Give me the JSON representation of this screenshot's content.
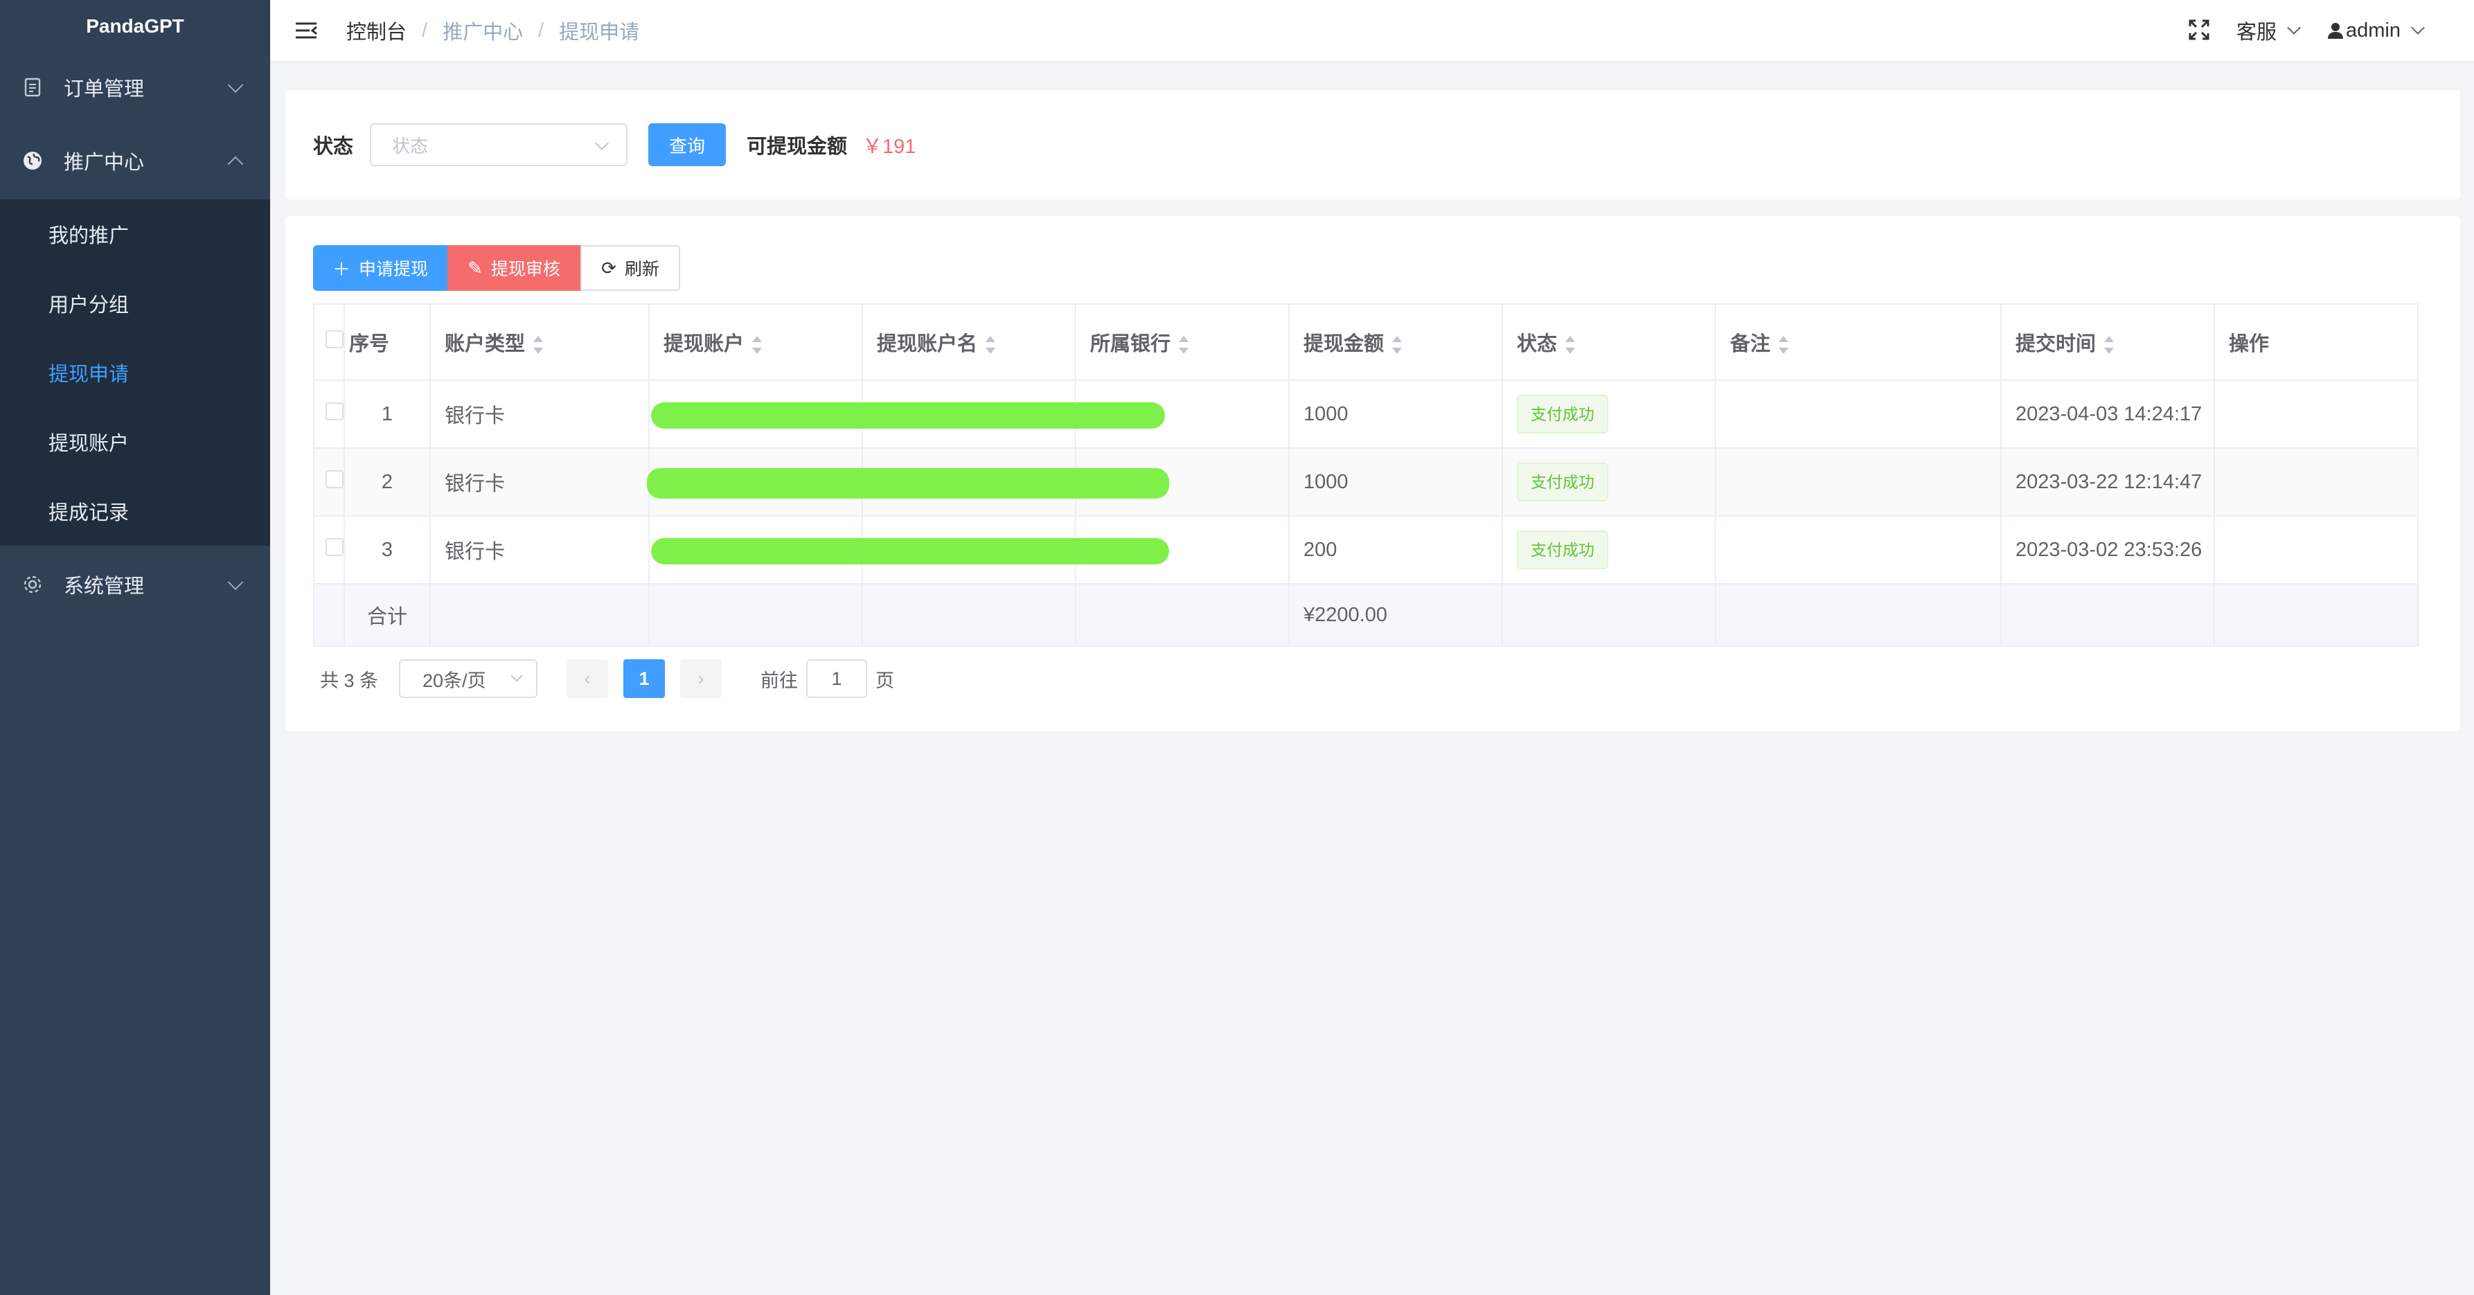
{
  "app": {
    "title": "PandaGPT"
  },
  "sidebar": {
    "items": [
      {
        "label": "订单管理",
        "icon": "document-icon",
        "expanded": false
      },
      {
        "label": "推广中心",
        "icon": "globe-icon",
        "expanded": true,
        "children": [
          "我的推广",
          "用户分组",
          "提现申请",
          "提现账户",
          "提成记录"
        ],
        "active_child": "提现申请"
      },
      {
        "label": "系统管理",
        "icon": "gear-icon",
        "expanded": false
      }
    ]
  },
  "header": {
    "breadcrumb": [
      "控制台",
      "推广中心",
      "提现申请"
    ],
    "service_label": "客服",
    "user_label": "admin"
  },
  "filter": {
    "status_label": "状态",
    "status_placeholder": "状态",
    "query_button": "查询",
    "available_label": "可提现金额",
    "available_value": "￥191"
  },
  "toolbar": {
    "apply_label": "申请提现",
    "audit_label": "提现审核",
    "refresh_label": "刷新"
  },
  "table": {
    "columns": [
      "序号",
      "账户类型",
      "提现账户",
      "提现账户名",
      "所属银行",
      "提现金额",
      "状态",
      "备注",
      "提交时间",
      "操作"
    ],
    "rows": [
      {
        "index": "1",
        "account_type": "银行卡",
        "amount": "1000",
        "status": "支付成功",
        "note": "",
        "time": "2023-04-03 14:24:17"
      },
      {
        "index": "2",
        "account_type": "银行卡",
        "amount": "1000",
        "status": "支付成功",
        "note": "",
        "time": "2023-03-22 12:14:47"
      },
      {
        "index": "3",
        "account_type": "银行卡",
        "amount": "200",
        "status": "支付成功",
        "note": "",
        "time": "2023-03-02 23:53:26"
      }
    ],
    "summary_label": "合计",
    "summary_amount": "¥2200.00"
  },
  "pagination": {
    "total_text": "共 3 条",
    "page_size": "20条/页",
    "current_page": "1",
    "goto_prefix": "前往",
    "goto_value": "1",
    "goto_suffix": "页"
  },
  "colors": {
    "sidebar_bg": "#304156",
    "submenu_bg": "#1f2d3d",
    "primary": "#409eff",
    "danger": "#f56c6c",
    "success": "#67c23a",
    "redaction": "#7ff04a"
  }
}
